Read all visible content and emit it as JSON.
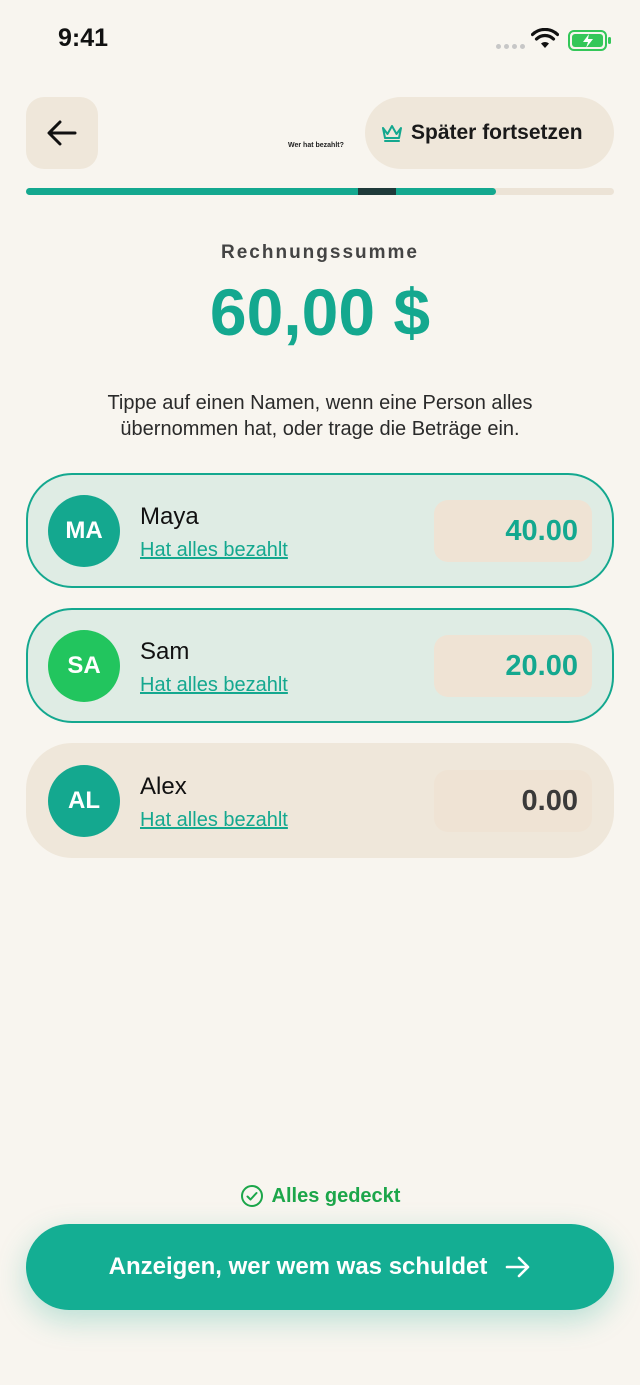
{
  "status_bar": {
    "time": "9:41"
  },
  "header": {
    "step_label": "Wer hat bezahlt?",
    "later_label": "Später fortsetzen",
    "progress": 0.8
  },
  "total": {
    "label": "Rechnungssumme",
    "amount": "60,00 $"
  },
  "instructions": "Tippe auf einen Namen, wenn eine Person alles übernommen hat, oder trage die Beträge ein.",
  "people": [
    {
      "initials": "MA",
      "name": "Maya",
      "link": "Hat alles bezahlt",
      "amount": "40.00",
      "avatar_color": "#14a88f",
      "amount_color": "#14a88f"
    },
    {
      "initials": "SA",
      "name": "Sam",
      "link": "Hat alles bezahlt",
      "amount": "20.00",
      "avatar_color": "#22c55e",
      "amount_color": "#14a88f"
    },
    {
      "initials": "AL",
      "name": "Alex",
      "link": "Hat alles bezahlt",
      "amount": "0.00",
      "avatar_color": "#14a88f",
      "amount_color": "#3a3a3a"
    }
  ],
  "footer": {
    "status_label": "Alles gedeckt",
    "primary_label": "Anzeigen, wer wem was schuldet"
  },
  "colors": {
    "accent": "#14a88f",
    "success": "#1ca64a",
    "background": "#f8f5ef"
  }
}
